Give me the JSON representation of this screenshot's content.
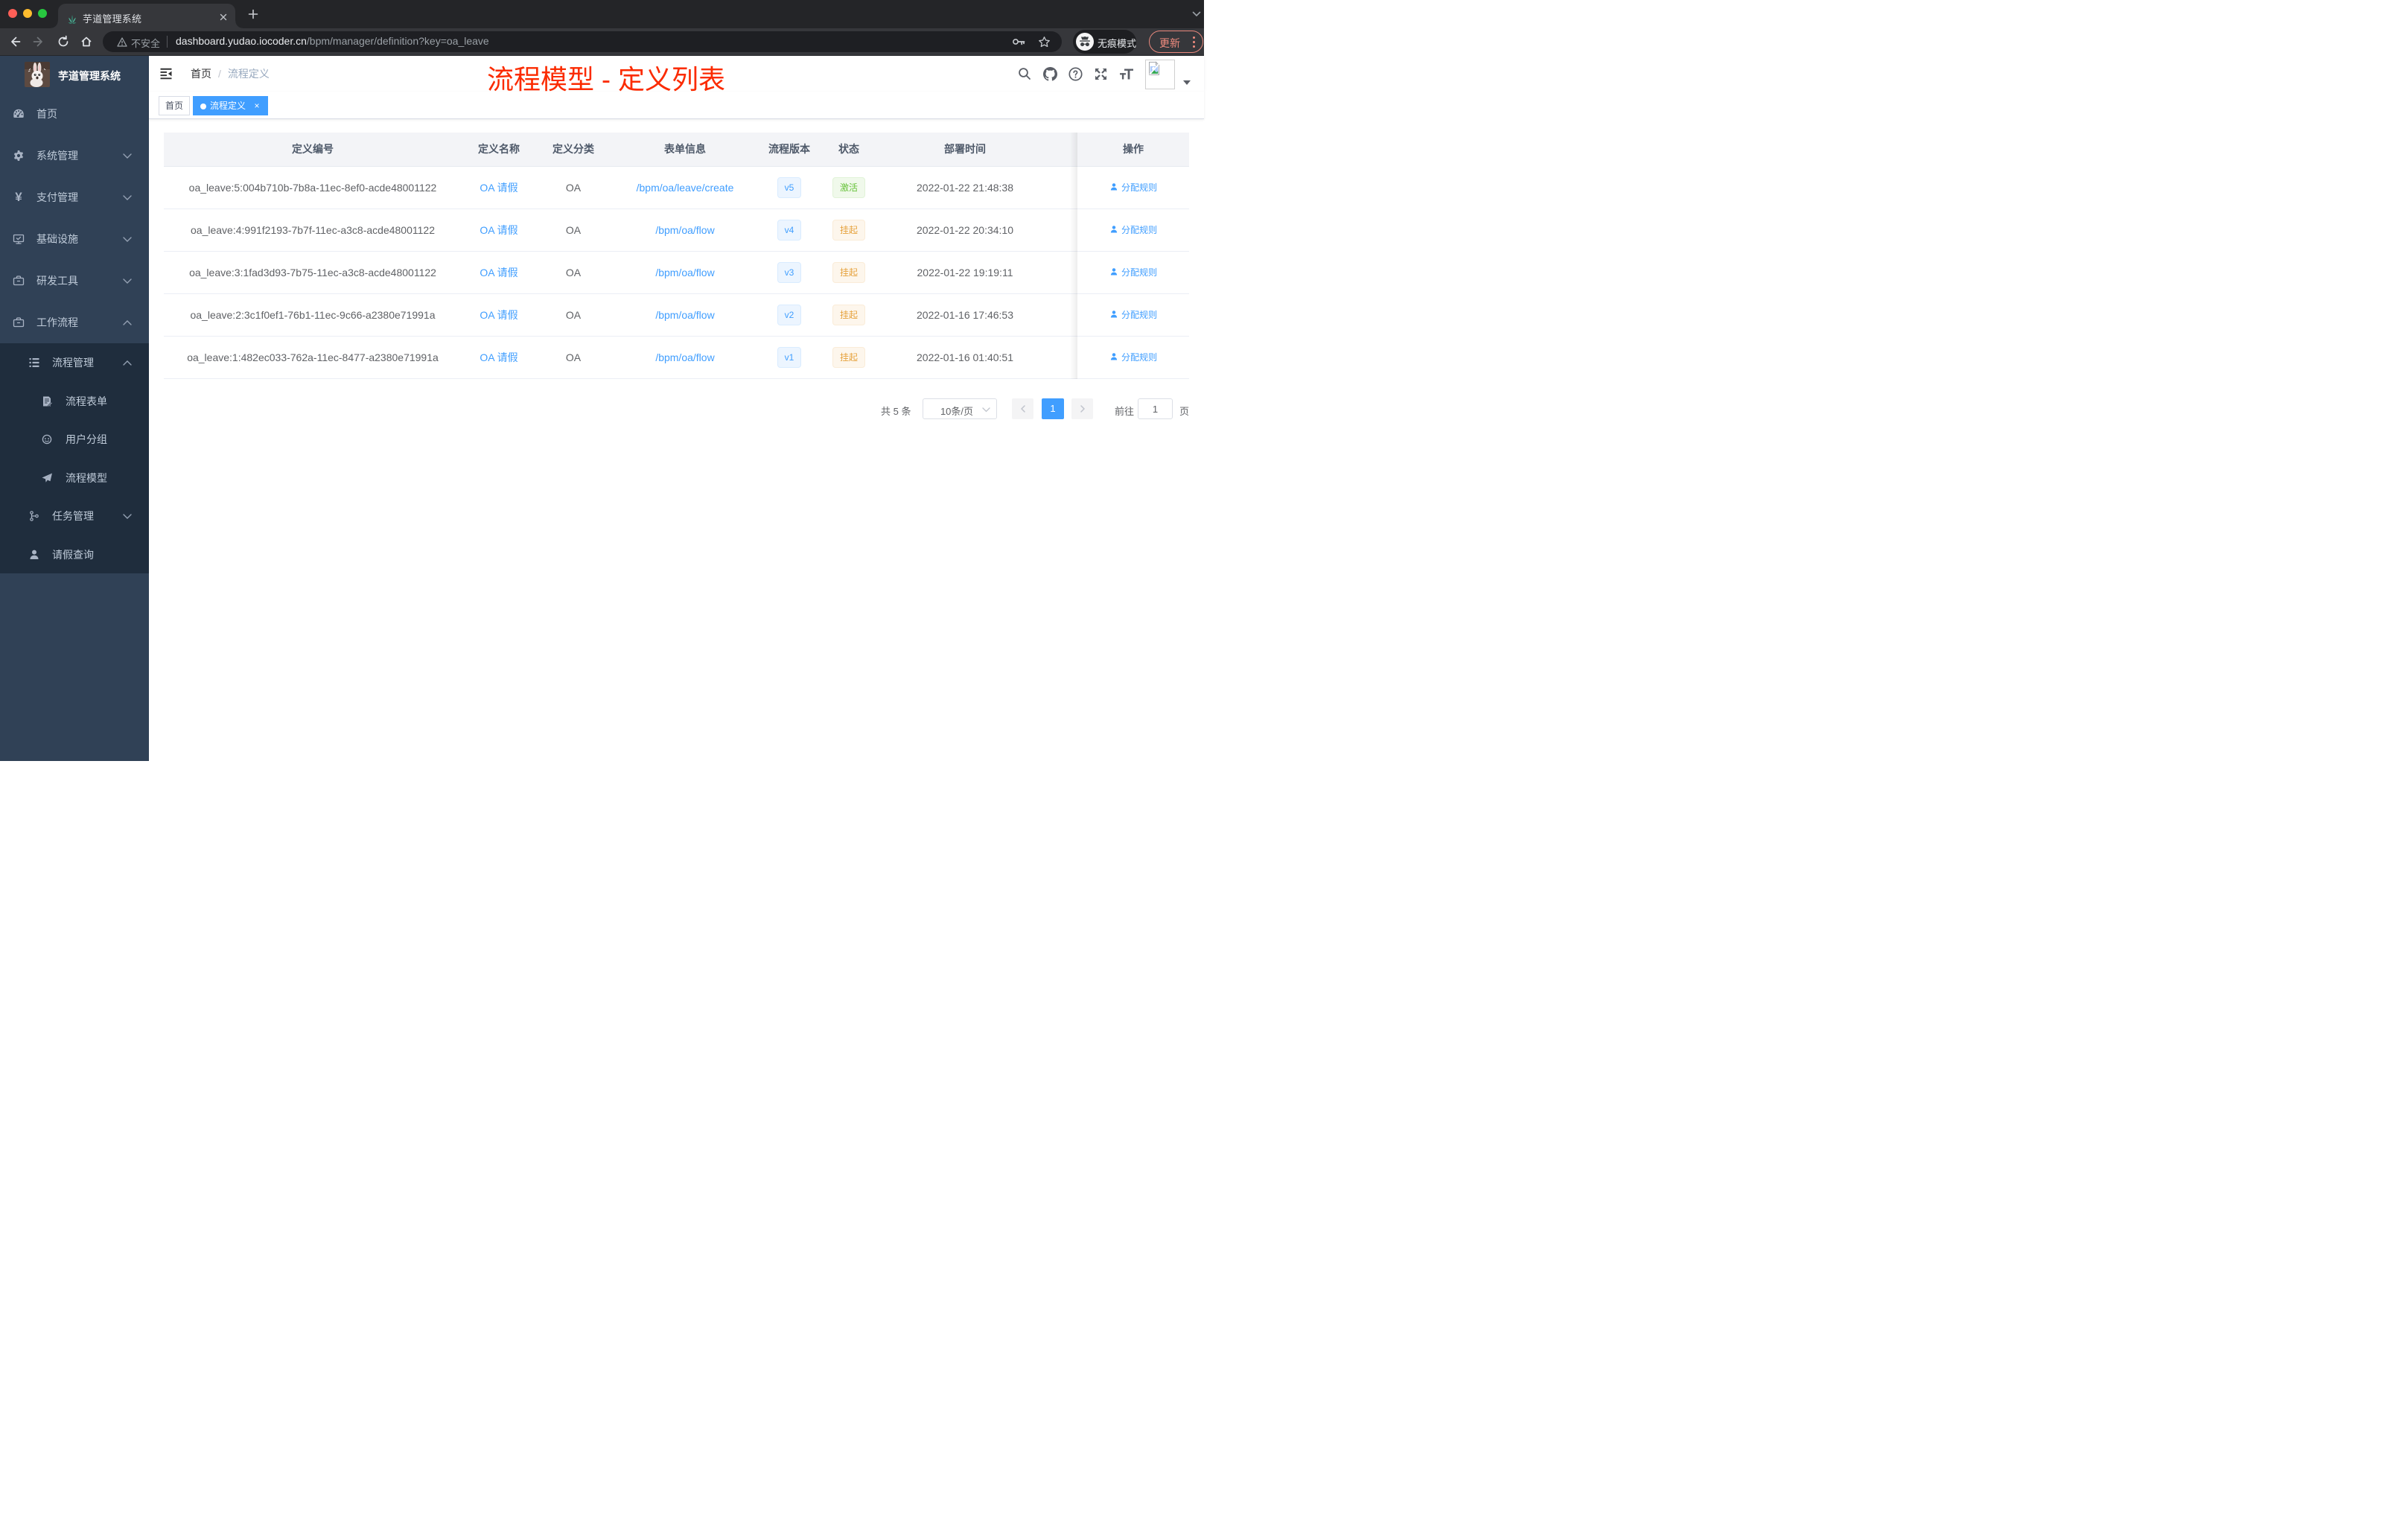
{
  "browser": {
    "tab_title": "芋道管理系统",
    "tab_close": "×",
    "url_security_label": "不安全",
    "url_host": "dashboard.yudao.iocoder.cn",
    "url_path": "/bpm/manager/definition?key=oa_leave",
    "incognito_label": "无痕模式",
    "update_label": "更新"
  },
  "sidebar": {
    "title": "芋道管理系统",
    "menu": [
      {
        "label": "首页",
        "icon": "dashboard",
        "expandable": false
      },
      {
        "label": "系统管理",
        "icon": "gear",
        "expandable": true,
        "expanded": false
      },
      {
        "label": "支付管理",
        "icon": "yen",
        "expandable": true,
        "expanded": false
      },
      {
        "label": "基础设施",
        "icon": "monitor",
        "expandable": true,
        "expanded": false
      },
      {
        "label": "研发工具",
        "icon": "toolbox",
        "expandable": true,
        "expanded": false
      },
      {
        "label": "工作流程",
        "icon": "briefcase",
        "expandable": true,
        "expanded": true
      }
    ],
    "submenu": [
      {
        "label": "流程管理",
        "icon": "list",
        "level": 2,
        "expandable": true,
        "expanded": true
      },
      {
        "label": "流程表单",
        "icon": "form",
        "level": 3
      },
      {
        "label": "用户分组",
        "icon": "people",
        "level": 3
      },
      {
        "label": "流程模型",
        "icon": "send",
        "level": 3
      },
      {
        "label": "任务管理",
        "icon": "tree",
        "level": 2,
        "expandable": true,
        "expanded": false
      },
      {
        "label": "请假查询",
        "icon": "user",
        "level": 2
      }
    ]
  },
  "navbar": {
    "breadcrumb": {
      "first": "首页",
      "separator": "/",
      "current": "流程定义"
    },
    "annotation": {
      "text": "流程模型 - 定义列表",
      "color": "#fb2b00"
    }
  },
  "tags": {
    "home": "首页",
    "active": "流程定义",
    "active_close": "×"
  },
  "table": {
    "headers": [
      "定义编号",
      "定义名称",
      "定义分类",
      "表单信息",
      "流程版本",
      "状态",
      "部署时间",
      "操作"
    ],
    "action_label": "分配规则",
    "rows": [
      {
        "id": "oa_leave:5:004b710b-7b8a-11ec-8ef0-acde48001122",
        "name": "OA 请假",
        "category": "OA",
        "form": "/bpm/oa/leave/create",
        "version": "v5",
        "status": "激活",
        "status_type": "success",
        "time": "2022-01-22 21:48:38",
        "action": "分配规则"
      },
      {
        "id": "oa_leave:4:991f2193-7b7f-11ec-a3c8-acde48001122",
        "name": "OA 请假",
        "category": "OA",
        "form": "/bpm/oa/flow",
        "version": "v4",
        "status": "挂起",
        "status_type": "warning",
        "time": "2022-01-22 20:34:10",
        "action": "分配规则"
      },
      {
        "id": "oa_leave:3:1fad3d93-7b75-11ec-a3c8-acde48001122",
        "name": "OA 请假",
        "category": "OA",
        "form": "/bpm/oa/flow",
        "version": "v3",
        "status": "挂起",
        "status_type": "warning",
        "time": "2022-01-22 19:19:11",
        "action": "分配规则"
      },
      {
        "id": "oa_leave:2:3c1f0ef1-76b1-11ec-9c66-a2380e71991a",
        "name": "OA 请假",
        "category": "OA",
        "form": "/bpm/oa/flow",
        "version": "v2",
        "status": "挂起",
        "status_type": "warning",
        "time": "2022-01-16 17:46:53",
        "action": "分配规则"
      },
      {
        "id": "oa_leave:1:482ec033-762a-11ec-8477-a2380e71991a",
        "name": "OA 请假",
        "category": "OA",
        "form": "/bpm/oa/flow",
        "version": "v1",
        "status": "挂起",
        "status_type": "warning",
        "time": "2022-01-16 01:40:51",
        "action": "分配规则"
      }
    ]
  },
  "pagination": {
    "total_label": "共 5 条",
    "page_size_label": "10条/页",
    "current_page": "1",
    "goto_label": "前往",
    "goto_value": "1",
    "unit_label": "页"
  },
  "colors": {
    "accent": "#409eff",
    "sidebar_bg": "#304156",
    "sidebar_sub_bg": "#1f2d3d",
    "status_active": "#67c23a",
    "status_suspended": "#e6a23c",
    "annotation_red": "#fb2b00"
  },
  "icons": {
    "chevron_down": "⌄",
    "chevron_up": "⌃",
    "close": "×",
    "plus": "+",
    "search": "magnifier",
    "github": "octocat",
    "help": "?",
    "fullscreen": "expand-arrows",
    "font_size": "Tt",
    "user": "person",
    "broken_image": "image-placeholder"
  }
}
